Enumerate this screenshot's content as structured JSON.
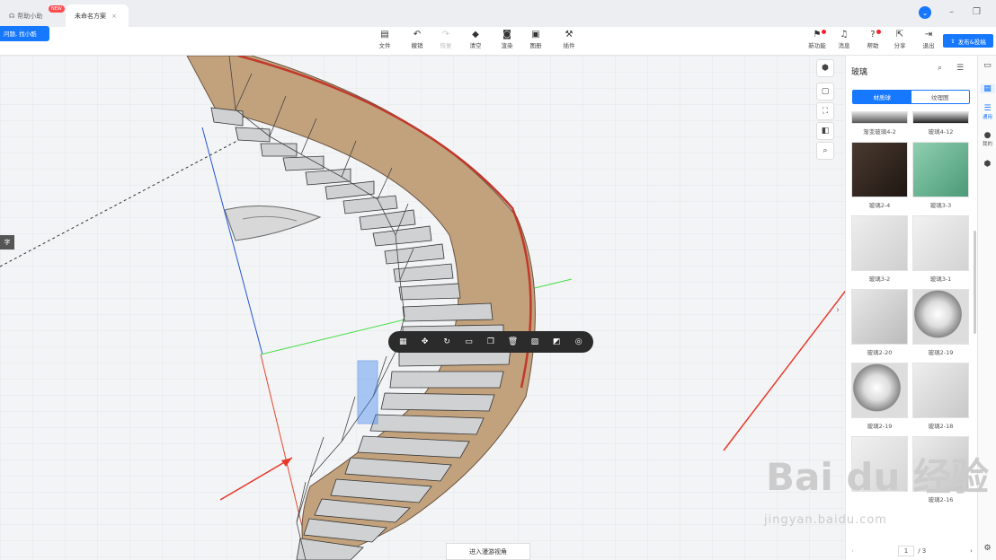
{
  "tabs": [
    {
      "label": "帮助小助",
      "badge": "NEW"
    },
    {
      "label": "未命名方案",
      "close": "×"
    }
  ],
  "bubble_text": "问题, 找小酷",
  "toolbar": {
    "items": [
      {
        "label": "文件",
        "icon": "file-icon"
      },
      {
        "label": "撤销",
        "icon": "undo-icon"
      },
      {
        "label": "恢复",
        "icon": "redo-icon"
      },
      {
        "label": "清空",
        "icon": "eraser-icon"
      },
      {
        "label": "渲染",
        "icon": "camera-icon"
      },
      {
        "label": "图册",
        "icon": "album-icon"
      },
      {
        "label": "插件",
        "icon": "plugin-icon"
      }
    ],
    "right_items": [
      {
        "label": "新功能",
        "icon": "flag-icon"
      },
      {
        "label": "消息",
        "icon": "bell-icon"
      },
      {
        "label": "帮助",
        "icon": "help-icon"
      },
      {
        "label": "分享",
        "icon": "share-icon"
      },
      {
        "label": "退出",
        "icon": "exit-icon"
      }
    ],
    "publish_label": "发布&投稿"
  },
  "viewport": {
    "left_tag": "字",
    "bottom_hint": "进入漫游视角"
  },
  "panel": {
    "title": "玻璃",
    "tab_active": "材质球",
    "tab_inactive": "纹理图",
    "items": [
      {
        "label": "渐变玻璃4-2"
      },
      {
        "label": "玻璃4-12"
      },
      {
        "label": "玻璃2-4"
      },
      {
        "label": "玻璃3-3"
      },
      {
        "label": "玻璃3-2"
      },
      {
        "label": "玻璃3-1"
      },
      {
        "label": "玻璃2-20"
      },
      {
        "label": "玻璃2-19"
      },
      {
        "label": "玻璃2-19"
      },
      {
        "label": "玻璃2-18"
      },
      {
        "label": ""
      },
      {
        "label": "玻璃2-16"
      }
    ],
    "page_current": "1",
    "page_total": "/ 3"
  },
  "right_strip": [
    {
      "label": "",
      "icon": "model-icon"
    },
    {
      "label": "",
      "icon": "grid-icon"
    },
    {
      "label": "通用",
      "icon": "list-icon"
    },
    {
      "label": "我的",
      "icon": "user-icon"
    },
    {
      "label": "",
      "icon": "cube-icon"
    }
  ],
  "watermark": {
    "main": "Bai du 经验",
    "sub": "jingyan.baidu.com"
  }
}
